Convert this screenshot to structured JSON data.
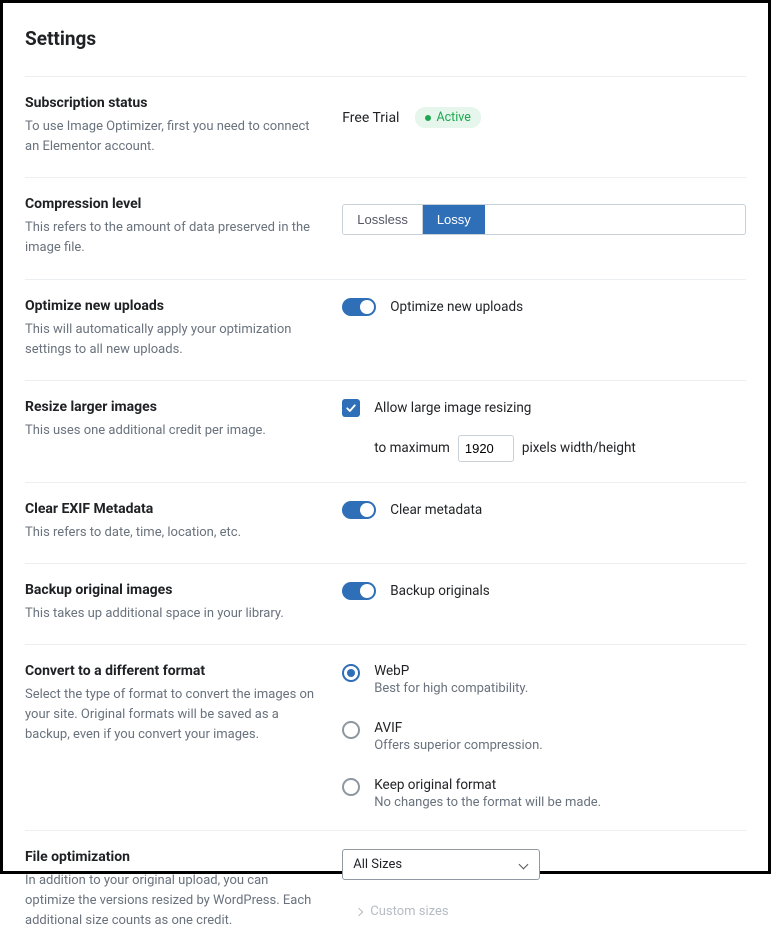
{
  "page_title": "Settings",
  "subscription": {
    "title": "Subscription status",
    "desc": "To use Image Optimizer, first you need to connect an Elementor account.",
    "plan": "Free Trial",
    "status": "Active"
  },
  "compression": {
    "title": "Compression level",
    "desc": "This refers to the amount of data preserved in the image file.",
    "options": {
      "lossless": "Lossless",
      "lossy": "Lossy"
    },
    "selected": "lossy"
  },
  "optimize_uploads": {
    "title": "Optimize new uploads",
    "desc": "This will automatically apply your optimization settings to all new uploads.",
    "toggle_label": "Optimize new uploads",
    "enabled": true
  },
  "resize": {
    "title": "Resize larger images",
    "desc": "This uses one additional credit per image.",
    "check_label": "Allow large image resizing",
    "checked": true,
    "prefix": "to maximum",
    "value": "1920",
    "suffix": "pixels width/height"
  },
  "exif": {
    "title": "Clear EXIF Metadata",
    "desc": "This refers to date, time, location, etc.",
    "toggle_label": "Clear metadata",
    "enabled": true
  },
  "backup": {
    "title": "Backup original images",
    "desc": "This takes up additional space in your library.",
    "toggle_label": "Backup originals",
    "enabled": true
  },
  "convert": {
    "title": "Convert to a different format",
    "desc": "Select the type of format to convert the images on your site. Original formats will be saved as a backup, even if you convert your images.",
    "options": [
      {
        "label": "WebP",
        "desc": "Best for high compatibility.",
        "selected": true
      },
      {
        "label": "AVIF",
        "desc": "Offers superior compression.",
        "selected": false
      },
      {
        "label": "Keep original format",
        "desc": "No changes to the format will be made.",
        "selected": false
      }
    ]
  },
  "file_opt": {
    "title": "File optimization",
    "desc": "In addition to your original upload, you can optimize the versions resized by WordPress. Each additional size counts as one credit.",
    "select_value": "All Sizes",
    "custom_sizes": "Custom sizes"
  }
}
